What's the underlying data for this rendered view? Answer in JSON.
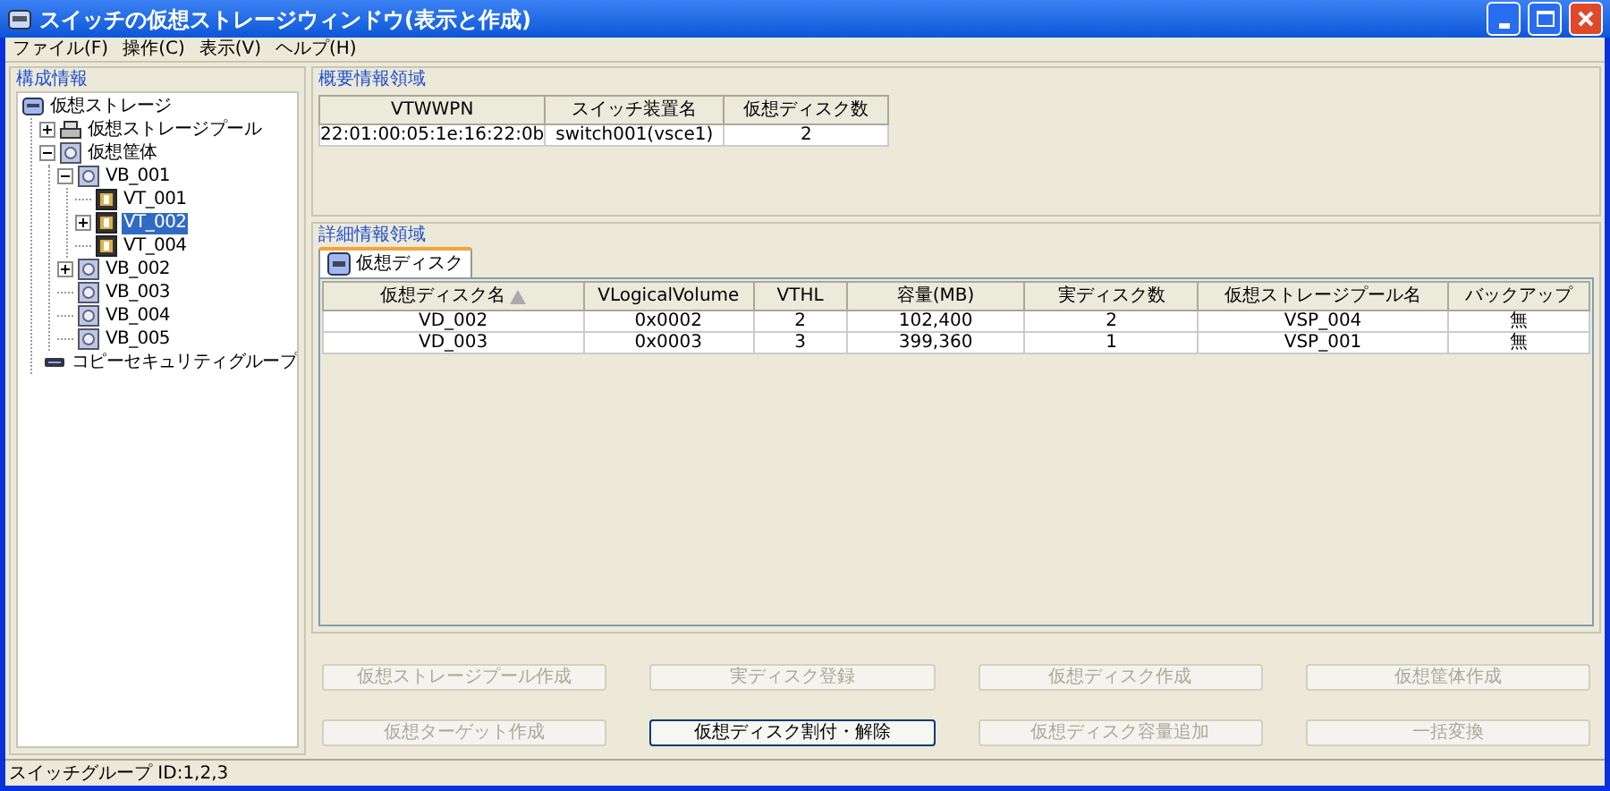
{
  "window": {
    "title": "スイッチの仮想ストレージウィンドウ(表示と作成)"
  },
  "menu": [
    "ファイル(F)",
    "操作(C)",
    "表示(V)",
    "ヘルプ(H)"
  ],
  "sidebar": {
    "title": "構成情報",
    "tree": [
      {
        "label": "仮想ストレージ",
        "kind": "storage",
        "selected": false,
        "children": [
          {
            "label": "仮想ストレージプール",
            "kind": "pool",
            "selected": false,
            "expanded": false
          },
          {
            "label": "仮想筐体",
            "kind": "box",
            "selected": false,
            "expanded": true,
            "children": [
              {
                "label": "VB_001",
                "kind": "box",
                "selected": false,
                "expanded": true,
                "children": [
                  {
                    "label": "VT_001",
                    "kind": "target",
                    "selected": false
                  },
                  {
                    "label": "VT_002",
                    "kind": "target",
                    "selected": true,
                    "expanded": false
                  },
                  {
                    "label": "VT_004",
                    "kind": "target",
                    "selected": false
                  }
                ]
              },
              {
                "label": "VB_002",
                "kind": "box",
                "selected": false,
                "expanded": false
              },
              {
                "label": "VB_003",
                "kind": "box",
                "selected": false
              },
              {
                "label": "VB_004",
                "kind": "box",
                "selected": false
              },
              {
                "label": "VB_005",
                "kind": "box",
                "selected": false
              }
            ]
          },
          {
            "label": "コピーセキュリティグループ",
            "kind": "group",
            "selected": false
          }
        ]
      }
    ]
  },
  "summary": {
    "title": "概要情報領域",
    "columns": [
      "VTWWPN",
      "スイッチ装置名",
      "仮想ディスク数"
    ],
    "rows": [
      [
        "22:01:00:05:1e:16:22:0b",
        "switch001(vsce1)",
        "2"
      ]
    ]
  },
  "details": {
    "title": "詳細情報領域",
    "tabs": [
      {
        "label": "仮想ディスク",
        "selected": true
      }
    ],
    "columns": [
      {
        "label": "仮想ディスク名",
        "sorted": true
      },
      {
        "label": "VLogicalVolume",
        "sorted": false
      },
      {
        "label": "VTHL",
        "sorted": false
      },
      {
        "label": "容量(MB)",
        "sorted": false
      },
      {
        "label": "実ディスク数",
        "sorted": false
      },
      {
        "label": "仮想ストレージプール名",
        "sorted": false
      },
      {
        "label": "バックアップ",
        "sorted": false
      }
    ],
    "rows": [
      [
        "VD_002",
        "0x0002",
        "2",
        "102,400",
        "2",
        "VSP_004",
        "無"
      ],
      [
        "VD_003",
        "0x0003",
        "3",
        "399,360",
        "1",
        "VSP_001",
        "無"
      ]
    ]
  },
  "buttons": [
    {
      "label": "仮想ストレージプール作成",
      "disabled": true
    },
    {
      "label": "実ディスク登録",
      "disabled": true
    },
    {
      "label": "仮想ディスク作成",
      "disabled": true
    },
    {
      "label": "仮想筐体作成",
      "disabled": true
    },
    {
      "label": "仮想ターゲット作成",
      "disabled": true
    },
    {
      "label": "仮想ディスク割付・解除",
      "disabled": false
    },
    {
      "label": "仮想ディスク容量追加",
      "disabled": true
    },
    {
      "label": "一括変換",
      "disabled": true
    }
  ],
  "status_bar": "スイッチグループ ID:1,2,3"
}
